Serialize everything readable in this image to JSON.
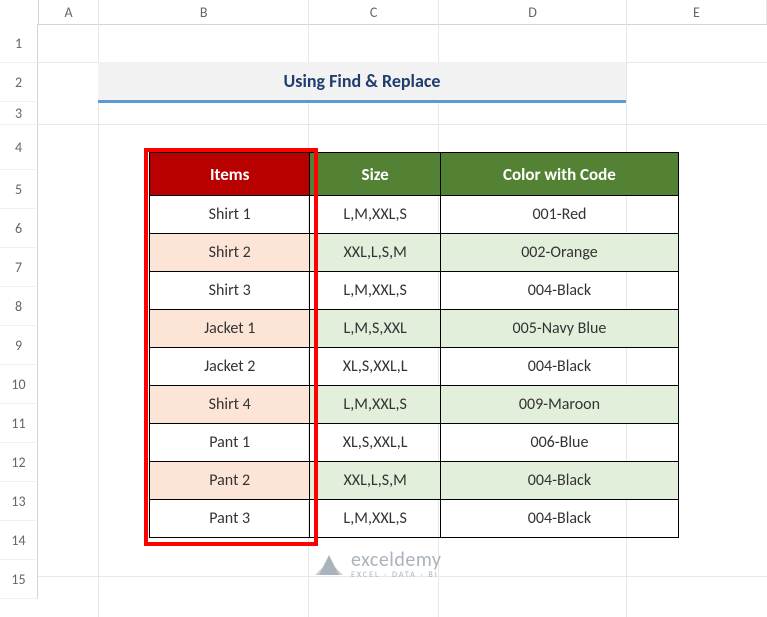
{
  "columns": [
    "A",
    "B",
    "C",
    "D",
    "E"
  ],
  "row_numbers": [
    1,
    2,
    3,
    4,
    5,
    6,
    7,
    8,
    9,
    10,
    11,
    12,
    13,
    14,
    15
  ],
  "title": "Using Find & Replace",
  "table": {
    "headers": {
      "items": "Items",
      "size": "Size",
      "color": "Color with Code"
    },
    "rows": [
      {
        "items": "Shirt 1",
        "size": "L,M,XXL,S",
        "color": "001-Red"
      },
      {
        "items": "Shirt 2",
        "size": "XXL,L,S,M",
        "color": "002-Orange"
      },
      {
        "items": "Shirt 3",
        "size": "L,M,XXL,S",
        "color": "004-Black"
      },
      {
        "items": "Jacket 1",
        "size": "L,M,S,XXL",
        "color": "005-Navy Blue"
      },
      {
        "items": "Jacket 2",
        "size": "XL,S,XXL,L",
        "color": "004-Black"
      },
      {
        "items": "Shirt 4",
        "size": "L,M,XXL,S",
        "color": "009-Maroon"
      },
      {
        "items": "Pant 1",
        "size": "XL,S,XXL,L",
        "color": "006-Blue"
      },
      {
        "items": "Pant 2",
        "size": "XXL,L,S,M",
        "color": "004-Black"
      },
      {
        "items": "Pant 3",
        "size": "L,M,XXL,S",
        "color": "004-Black"
      }
    ]
  },
  "watermark": {
    "brand": "exceldemy",
    "sub": "EXCEL · DATA · BI"
  },
  "chart_data": {
    "type": "table",
    "title": "Using Find & Replace",
    "columns": [
      "Items",
      "Size",
      "Color with Code"
    ],
    "rows": [
      [
        "Shirt 1",
        "L,M,XXL,S",
        "001-Red"
      ],
      [
        "Shirt 2",
        "XXL,L,S,M",
        "002-Orange"
      ],
      [
        "Shirt 3",
        "L,M,XXL,S",
        "004-Black"
      ],
      [
        "Jacket 1",
        "L,M,S,XXL",
        "005-Navy Blue"
      ],
      [
        "Jacket 2",
        "XL,S,XXL,L",
        "004-Black"
      ],
      [
        "Shirt 4",
        "L,M,XXL,S",
        "009-Maroon"
      ],
      [
        "Pant 1",
        "XL,S,XXL,L",
        "006-Blue"
      ],
      [
        "Pant 2",
        "XXL,L,S,M",
        "004-Black"
      ],
      [
        "Pant 3",
        "L,M,XXL,S",
        "004-Black"
      ]
    ]
  }
}
